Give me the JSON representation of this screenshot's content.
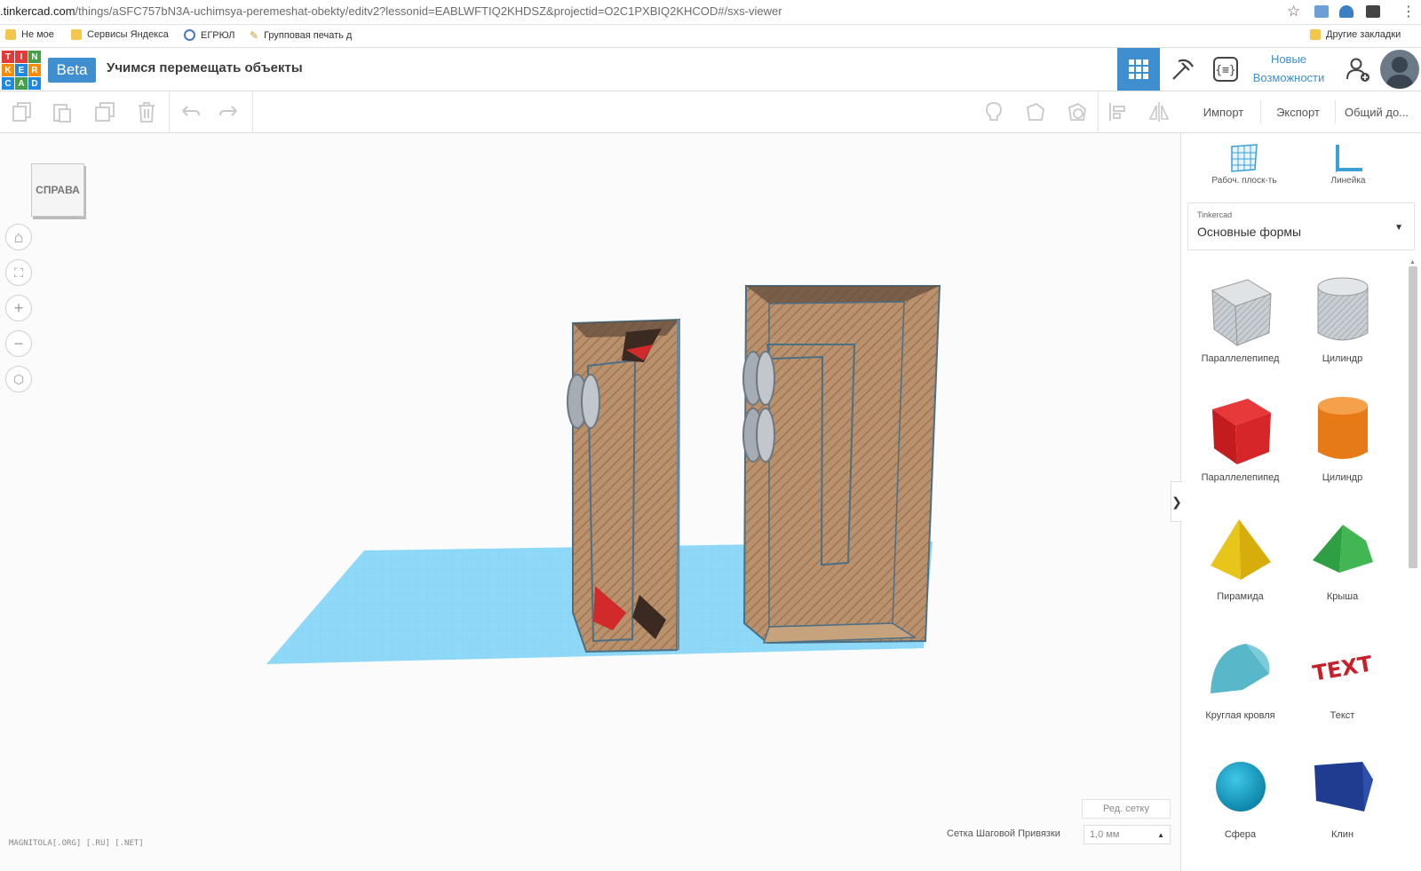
{
  "browser": {
    "url_host": ".tinkercad.com",
    "url_path": "/things/aSFC757bN3A-uchimsya-peremeshat-obekty/editv2?lessonid=EABLWFTIQ2KHDSZ&projectid=O2C1PXBIQ2KHCOD#/sxs-viewer",
    "bookmarks": [
      {
        "label": "Не мое",
        "icon": "folder-icon"
      },
      {
        "label": "Сервисы Яндекса",
        "icon": "folder-icon"
      },
      {
        "label": "ЕГРЮЛ",
        "icon": "globe-icon"
      },
      {
        "label": "Групповая печать д",
        "icon": "pencil-icon"
      }
    ],
    "other_bookmarks": "Другие закладки"
  },
  "app": {
    "logo_letters": [
      "T",
      "I",
      "N",
      "K",
      "E",
      "R",
      "C",
      "A",
      "D"
    ],
    "logo_colors": [
      "#e53935",
      "#e53935",
      "#43a047",
      "#fb8c00",
      "#1e88e5",
      "#fb8c00",
      "#1e88e5",
      "#43a047",
      "#1e88e5"
    ],
    "beta_label": "Beta",
    "project_title": "Учимся перемещать объекты",
    "new_features_line1": "Новые",
    "new_features_line2": "Возможности",
    "accent_color": "#3e8ed0"
  },
  "toolbar": {
    "import_label": "Импорт",
    "export_label": "Экспорт",
    "share_label": "Общий до..."
  },
  "viewport": {
    "viewcube_label": "СПРАВА",
    "edit_grid_label": "Ред. сетку",
    "snap_label": "Сетка Шаговой Привязки",
    "snap_value": "1,0 мм",
    "watermark": "MAGNITOLA[.ORG] [.RU] [.NET]"
  },
  "panel": {
    "workplane_label": "Рабоч. плоск-ть",
    "ruler_label": "Линейка",
    "library_source": "Tinkercad",
    "library_name": "Основные формы",
    "shapes": [
      {
        "label": "Параллелепипед",
        "icon": "box-hole-icon"
      },
      {
        "label": "Цилиндр",
        "icon": "cylinder-hole-icon"
      },
      {
        "label": "Параллелепипед",
        "icon": "box-red-icon"
      },
      {
        "label": "Цилиндр",
        "icon": "cylinder-orange-icon"
      },
      {
        "label": "Пирамида",
        "icon": "pyramid-icon"
      },
      {
        "label": "Крыша",
        "icon": "roof-icon"
      },
      {
        "label": "Круглая кровля",
        "icon": "round-roof-icon"
      },
      {
        "label": "Текст",
        "icon": "text-shape-icon"
      },
      {
        "label": "Сфера",
        "icon": "sphere-icon"
      },
      {
        "label": "Клин",
        "icon": "wedge-icon"
      }
    ],
    "text_shape_word": "TEXT"
  }
}
